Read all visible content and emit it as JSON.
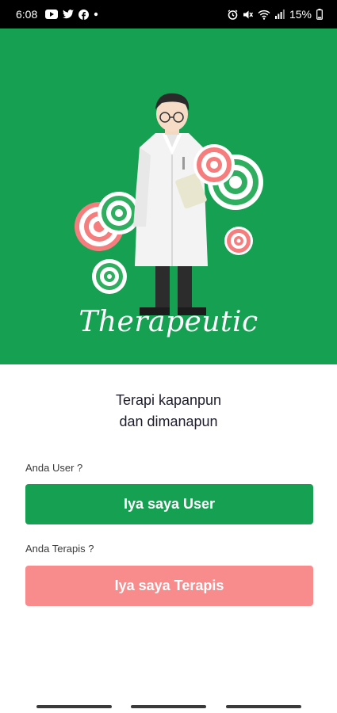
{
  "status_bar": {
    "time": "6:08",
    "left_icons": [
      "youtube-icon",
      "twitter-icon",
      "facebook-icon",
      "dot-icon"
    ],
    "right_icons": [
      "alarm-icon",
      "mute-icon",
      "wifi-icon",
      "signal-icon"
    ],
    "battery": "15%"
  },
  "hero": {
    "brand": "Therapeutic"
  },
  "tagline": {
    "line1": "Terapi kapanpun",
    "line2": "dan dimanapun"
  },
  "user_section": {
    "question": "Anda User ?",
    "button_label": "Iya saya User"
  },
  "terapis_section": {
    "question": "Anda Terapis ?",
    "button_label": "Iya saya Terapis"
  },
  "colors": {
    "primary_green": "#15a052",
    "accent_pink": "#f88c8c",
    "text_dark": "#1d1d2c"
  }
}
